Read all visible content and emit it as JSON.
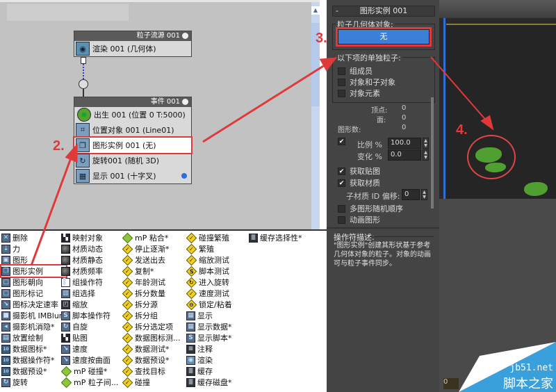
{
  "particle_view": {
    "source_node": {
      "title": "粒子流源 001",
      "operators": [
        {
          "icon": "render-icon",
          "label": "渲染 001 (几何体)"
        }
      ]
    },
    "event_node": {
      "title": "事件 001",
      "operators": [
        {
          "icon": "birth-icon",
          "label": "出生 001 (位置 0 T:5000)"
        },
        {
          "icon": "position-object-icon",
          "label": "位置对象 001 (Line01)"
        },
        {
          "icon": "shape-instance-icon",
          "label": "图形实例 001 (无)",
          "highlighted": true
        },
        {
          "icon": "rotation-icon",
          "label": "旋转001 (随机 3D)"
        },
        {
          "icon": "display-icon",
          "label": "显示 001 (十字叉)"
        }
      ]
    }
  },
  "annotations": {
    "step2": "2.",
    "step3": "3.",
    "step4": "4."
  },
  "depot": {
    "columns": [
      [
        {
          "icon": "delete-icon",
          "label": "删除"
        },
        {
          "icon": "force-icon",
          "label": "力"
        },
        {
          "icon": "shape-icon",
          "label": "图形"
        },
        {
          "icon": "shape-instance-icon",
          "label": "图形实例",
          "selected": true
        },
        {
          "icon": "shape-facing-icon",
          "label": "图形朝向"
        },
        {
          "icon": "shape-mark-icon",
          "label": "图形标记"
        },
        {
          "icon": "icon-determine-rate-icon",
          "label": "图标决定速率"
        },
        {
          "icon": "camera-imblur-icon",
          "label": "摄影机 IMBlur*"
        },
        {
          "icon": "camera-culling-icon",
          "label": "摄影机消隐*"
        },
        {
          "icon": "placement-paint-icon",
          "label": "放置绘制"
        },
        {
          "icon": "data-icon-icon",
          "label": "数据图标*"
        },
        {
          "icon": "data-operator-icon",
          "label": "数据操作符*"
        },
        {
          "icon": "data-preset-icon",
          "label": "数据预设*"
        },
        {
          "icon": "spin-icon",
          "label": "旋转"
        }
      ],
      [
        {
          "icon": "mapping-object-icon",
          "label": "映射对象"
        },
        {
          "icon": "material-dynamic-icon",
          "label": "材质动态"
        },
        {
          "icon": "material-static-icon",
          "label": "材质静态"
        },
        {
          "icon": "material-frequency-icon",
          "label": "材质频率"
        },
        {
          "icon": "group-operator-icon",
          "label": "组操作符"
        },
        {
          "icon": "group-select-icon",
          "label": "组选择"
        },
        {
          "icon": "scale-icon",
          "label": "缩放"
        },
        {
          "icon": "script-operator-icon",
          "label": "脚本操作符"
        },
        {
          "icon": "auto-spin-icon",
          "label": "自旋"
        },
        {
          "icon": "mapping-icon",
          "label": "贴图"
        },
        {
          "icon": "speed-icon",
          "label": "速度"
        },
        {
          "icon": "speed-by-surface-icon",
          "label": "速度按曲面"
        },
        {
          "icon": "mp-collision-icon",
          "label": "mP 碰撞*"
        },
        {
          "icon": "mp-interparticle-icon",
          "label": "mP 粒子间..."
        }
      ],
      [
        {
          "icon": "mp-glue-icon",
          "label": "mP 粘合*"
        },
        {
          "icon": "stop-gradually-icon",
          "label": "停止逐渐*"
        },
        {
          "icon": "send-out-icon",
          "label": "发送出去"
        },
        {
          "icon": "copy-icon",
          "label": "复制*"
        },
        {
          "icon": "age-test-icon",
          "label": "年龄测试"
        },
        {
          "icon": "split-amount-icon",
          "label": "拆分数量"
        },
        {
          "icon": "split-source-icon",
          "label": "拆分源"
        },
        {
          "icon": "split-group-icon",
          "label": "拆分组"
        },
        {
          "icon": "split-selected-icon",
          "label": "拆分选定项"
        },
        {
          "icon": "data-icon-test-icon",
          "label": "数据图标测..."
        },
        {
          "icon": "data-test-icon",
          "label": "数据测试*"
        },
        {
          "icon": "data-preset-test-icon",
          "label": "数据预设*"
        },
        {
          "icon": "find-target-icon",
          "label": "查找目标"
        },
        {
          "icon": "collision-icon",
          "label": "碰撞"
        }
      ],
      [
        {
          "icon": "collision-spawn-icon",
          "label": "碰撞繁殖"
        },
        {
          "icon": "spawn-icon",
          "label": "繁殖"
        },
        {
          "icon": "scale-test-icon",
          "label": "缩放测试"
        },
        {
          "icon": "script-test-icon",
          "label": "脚本测试"
        },
        {
          "icon": "go-to-rotation-icon",
          "label": "进入旋转"
        },
        {
          "icon": "speed-test-icon",
          "label": "速度测试"
        },
        {
          "icon": "lock-bond-icon",
          "label": "锁定/粘着"
        },
        {
          "icon": "display-icon",
          "label": "显示"
        },
        {
          "icon": "display-data-icon",
          "label": "显示数据*"
        },
        {
          "icon": "display-script-icon",
          "label": "显示脚本*"
        },
        {
          "icon": "notes-icon",
          "label": "注释"
        },
        {
          "icon": "render-icon",
          "label": "渲染"
        },
        {
          "icon": "cache-icon",
          "label": "缓存"
        },
        {
          "icon": "cache-disk-icon",
          "label": "缓存磁盘*"
        }
      ],
      [
        {
          "icon": "cache-selective-icon",
          "label": "缓存选择性*"
        }
      ]
    ]
  },
  "panel": {
    "rollout_title": "图形实例 001",
    "collapse_symbol": "-",
    "geometry_group_label": "粒子几何体对象:",
    "geometry_button": "无",
    "separate_group_label": "以下项的单独粒子:",
    "separate_options": [
      {
        "label": "组成员",
        "checked": false
      },
      {
        "label": "对象和子对象",
        "checked": false
      },
      {
        "label": "对象元素",
        "checked": false
      }
    ],
    "stats": {
      "vertices_label": "顶点:",
      "vertices": "0",
      "faces_label": "面:",
      "faces": "0",
      "shapes_label": "图形数:",
      "shapes": "0"
    },
    "scale_checked": true,
    "scale_label": "比例 %",
    "scale_value": "100.0",
    "variation_label": "变化 %",
    "variation_value": "0.0",
    "acquire_mapping_label": "获取贴图",
    "acquire_mapping_checked": true,
    "acquire_material_label": "获取材质",
    "acquire_material_checked": true,
    "submaterial_offset_label": "子材质 ID 偏移:",
    "submaterial_offset_value": "0",
    "multi_shape_label": "多图形随机顺序",
    "multi_shape_checked": false,
    "animated_shape_label": "动画图形",
    "animated_shape_checked": false,
    "description_title": "操作符描述:",
    "description_text": "\"图形实例\"创建其形状基于参考几何体对象的粒子。对象的动画可与粒子事件同步。"
  },
  "viewport": {
    "frame_label": "0"
  },
  "watermark": {
    "url": "jb51.net",
    "name": "脚本之家"
  },
  "colors": {
    "highlight_red": "#e0393a",
    "button_blue": "#3b7fd8",
    "panel_bg": "#444444",
    "canvas_bg": "#c2c2c2",
    "leaf_green": "#4fa030"
  }
}
